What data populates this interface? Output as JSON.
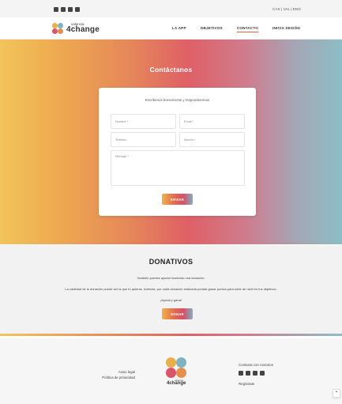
{
  "topbar": {
    "social_icons": [
      "instagram-icon",
      "facebook-icon",
      "youtube-icon",
      "email-icon"
    ],
    "languages": "CAS | VAL | ENG"
  },
  "header": {
    "logo_small": "valencia",
    "logo_big": "4change",
    "nav": [
      {
        "label": "LA APP",
        "active": false
      },
      {
        "label": "OBJETIVOS",
        "active": false
      },
      {
        "label": "CONTACTO",
        "active": true
      },
      {
        "label": "INICIA SESIÓN",
        "active": false
      }
    ]
  },
  "contact": {
    "title": "Contáctanos",
    "subtitle": "Escríbenos brevemente y responderemos",
    "fields": {
      "name_placeholder": "Nombre *",
      "email_placeholder": "Email *",
      "phone_placeholder": "Teléfono",
      "subject_placeholder": "Asunto *",
      "message_placeholder": "Mensaje *"
    },
    "send_label": "ENVIAR"
  },
  "donate": {
    "title": "DONATIVOS",
    "line1": "También puedes ayudar haciendo una donación.",
    "line2": "La cantidad de la donación puede ser la que tú quieras. Además, por cada donación realizada podrás ganar puntos para subir de nivel en tus objetivos.",
    "line3": "¡Ayuda y gana!",
    "button_label": "DONAR"
  },
  "footer": {
    "legal": "Aviso legal",
    "privacy": "Política de privacidad",
    "logo_small": "valencia",
    "logo_big": "4change",
    "contact_label": "Contacta con nosotros",
    "social_icons": [
      "instagram-icon",
      "facebook-icon",
      "youtube-icon",
      "email-icon"
    ],
    "register": "Regístrate"
  },
  "scroll_top_glyph": "⌃",
  "colors": {
    "accent_orange": "#e0613f",
    "gradient": [
      "#f2c45a",
      "#e5875a",
      "#df6066",
      "#cf7c8e",
      "#8bbec6"
    ]
  }
}
